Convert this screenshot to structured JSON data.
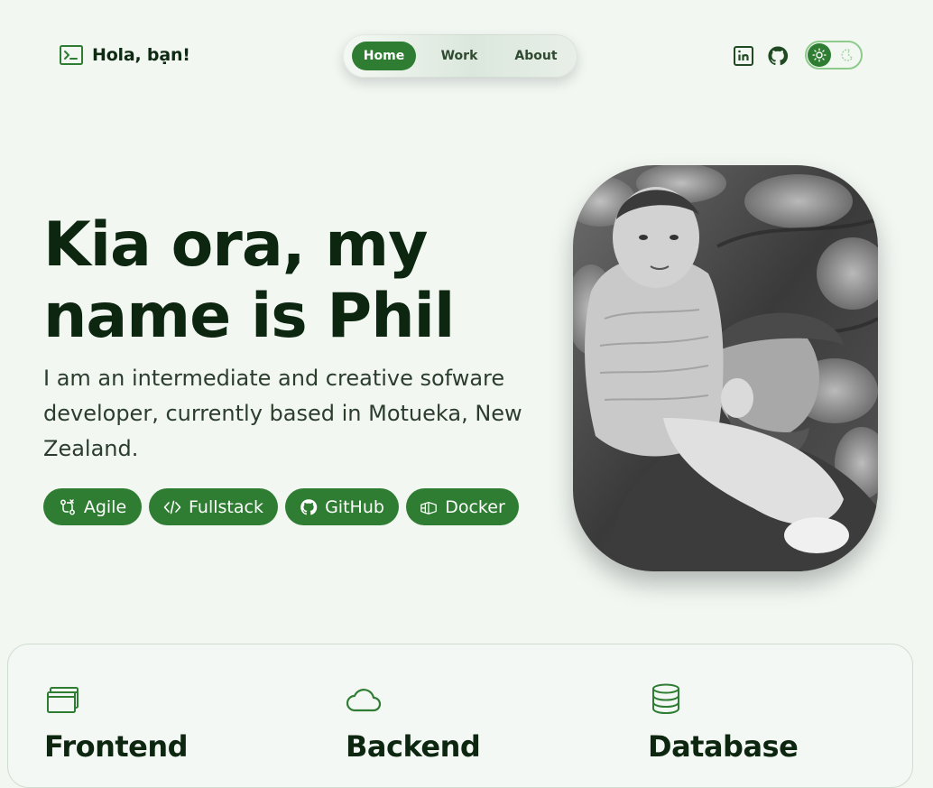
{
  "header": {
    "brand": "Hola, bạn!",
    "brand_icon": "terminal-icon",
    "nav": [
      {
        "label": "Home",
        "active": true
      },
      {
        "label": "Work",
        "active": false
      },
      {
        "label": "About",
        "active": false
      }
    ],
    "social_icons": [
      "linkedin-icon",
      "github-icon"
    ],
    "theme_toggle": {
      "state": "light",
      "icons": [
        "sun-icon",
        "moon-icon"
      ]
    }
  },
  "hero": {
    "title_line1": "Kia ora, my",
    "title_line2": "name is Phil",
    "intro": "I am an intermediate and creative sofware developer, currently based in Motueka, New Zealand.",
    "chips": [
      {
        "label": "Agile",
        "icon": "git-compare-icon"
      },
      {
        "label": "Fullstack",
        "icon": "code-icon"
      },
      {
        "label": "GitHub",
        "icon": "github-icon"
      },
      {
        "label": "Docker",
        "icon": "container-icon"
      }
    ],
    "photo": "black-and-white photo of man carrying child on shoulders"
  },
  "services": [
    {
      "title": "Frontend",
      "icon": "browser-windows-icon"
    },
    {
      "title": "Backend",
      "icon": "cloud-icon"
    },
    {
      "title": "Database",
      "icon": "database-icon"
    }
  ],
  "colors": {
    "accent": "#2e7d32",
    "background": "#f2f7f2",
    "text": "#0c2610"
  }
}
